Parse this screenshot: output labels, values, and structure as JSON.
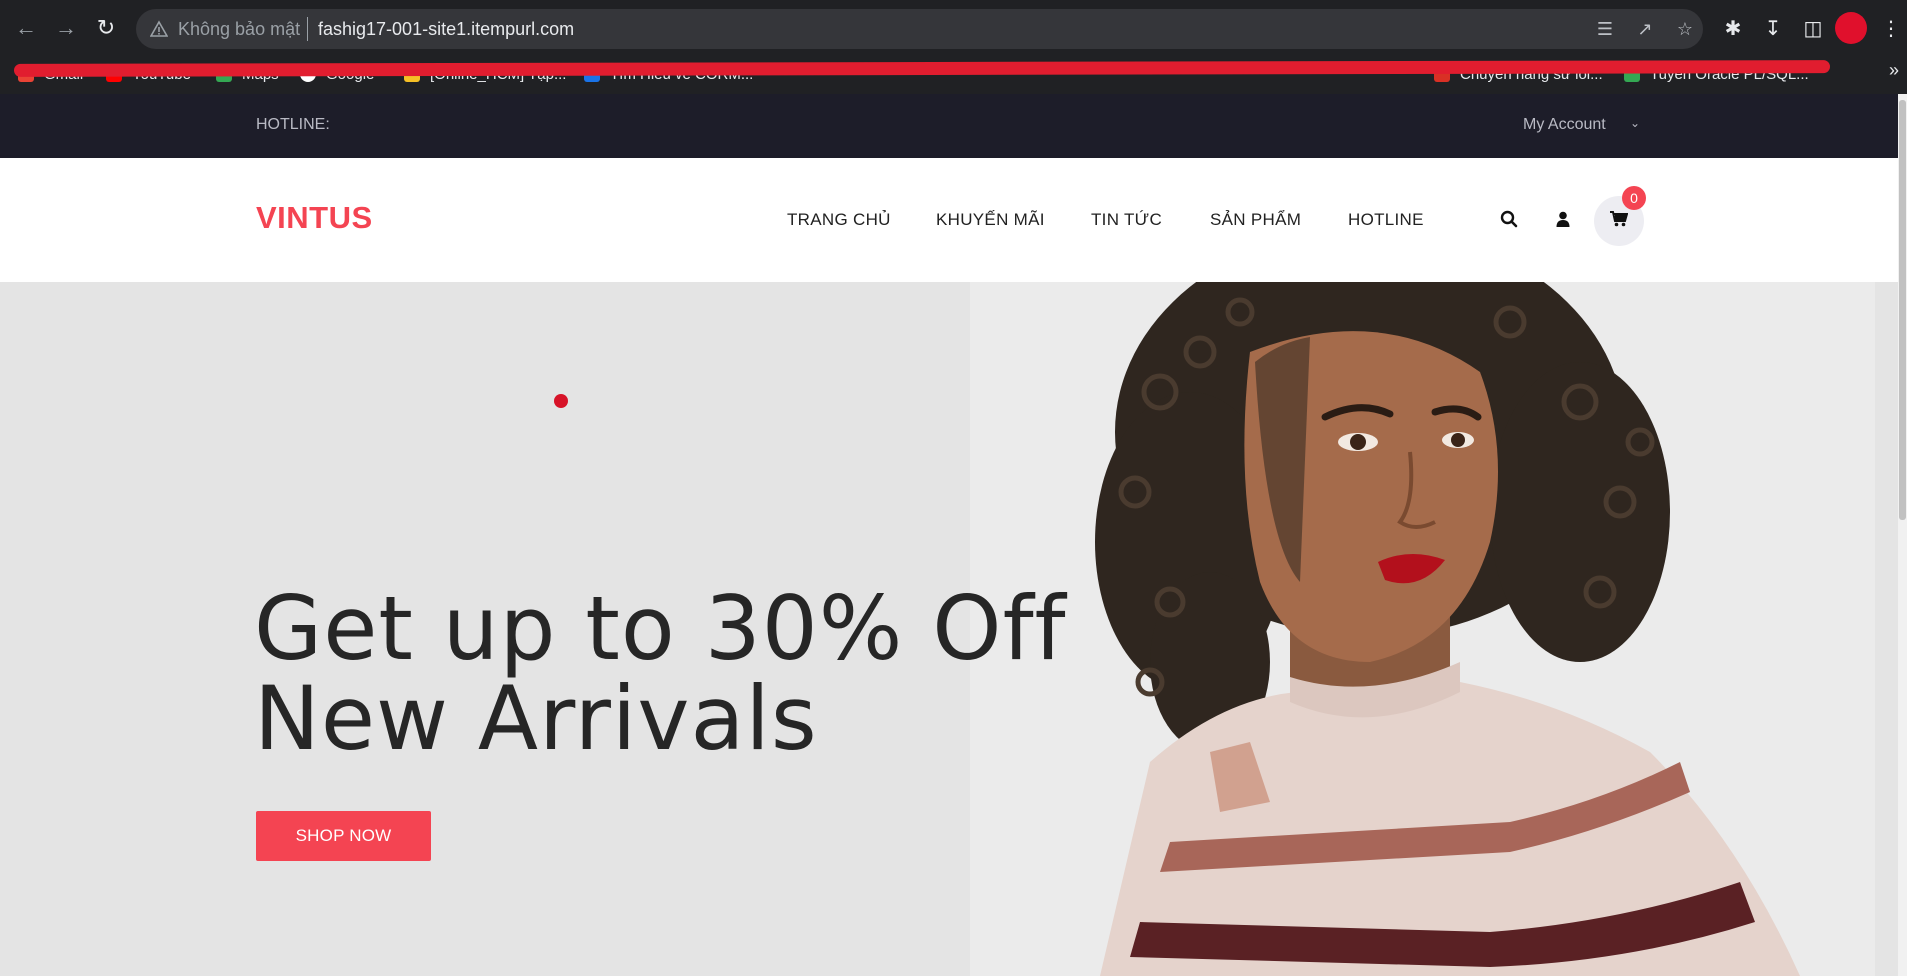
{
  "browser": {
    "security_label": "Không bảo mật",
    "url": "fashig17-001-site1.itempurl.com",
    "bookmarks": [
      {
        "label": "Gmail",
        "color": "#ea4335"
      },
      {
        "label": "YouTube",
        "color": "#ff0000"
      },
      {
        "label": "Maps",
        "color": "#34a853"
      },
      {
        "label": "Google",
        "color": "#ffffff"
      },
      {
        "label": "[Online_HCM] Tập...",
        "color": "#f6c026"
      },
      {
        "label": "Tìm Hiểu về CORM...",
        "color": "#1a73e8"
      },
      {
        "label": "Chuyển hàng sử lối...",
        "color": "#d93025"
      },
      {
        "label": "Tuyển Oracle PL/SQL...",
        "color": "#34a853"
      }
    ]
  },
  "site": {
    "hotline_label": "HOTLINE:",
    "account_label": "My Account",
    "logo": "VINTUS",
    "menu": [
      "TRANG CHỦ",
      "KHUYẾN MÃI",
      "TIN TỨC",
      "SẢN PHẨM",
      "HOTLINE"
    ],
    "cart_count": "0",
    "accent_color": "#f44452"
  },
  "hero": {
    "headline_line1": "Get up to 30% Off",
    "headline_line2": "New Arrivals",
    "cta_label": "SHOP NOW"
  }
}
